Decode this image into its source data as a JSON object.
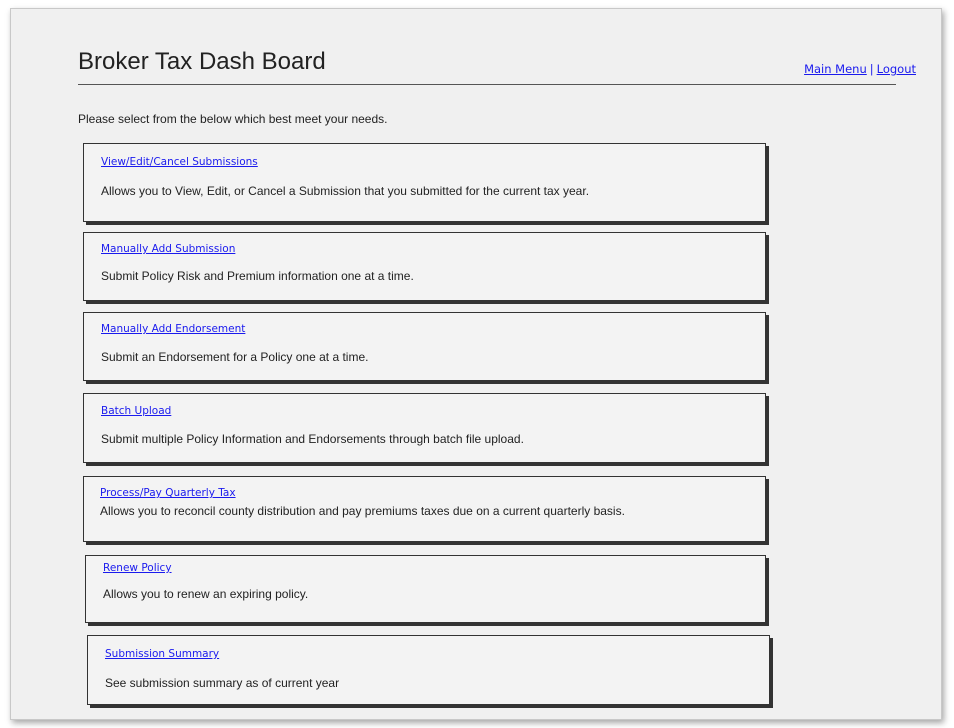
{
  "header": {
    "title": "Broker Tax Dash Board",
    "nav": {
      "main_menu": "Main Menu",
      "separator": "|",
      "logout": "Logout"
    }
  },
  "intro_text": "Please select from the below which best meet your needs.",
  "options": [
    {
      "link": "View/Edit/Cancel Submissions",
      "description": "Allows you to View, Edit, or Cancel a Submission that you submitted for the current tax year."
    },
    {
      "link": "Manually Add Submission",
      "description": "Submit Policy Risk and Premium information one at a time."
    },
    {
      "link": "Manually Add Endorsement",
      "description": "Submit an Endorsement for a Policy one at a time."
    },
    {
      "link": "Batch Upload",
      "description": "Submit multiple Policy Information and Endorsements through batch file upload."
    },
    {
      "link": "Process/Pay Quarterly Tax",
      "description": "Allows you to reconcil county distribution and pay premiums taxes due on a current quarterly basis."
    },
    {
      "link": "Renew Policy",
      "description": "Allows you to renew an expiring policy."
    },
    {
      "link": "Submission Summary",
      "description": "See submission summary as of current year"
    }
  ],
  "colors": {
    "link": "#1a1aee",
    "background": "#f0f0f0",
    "card_border": "#333333"
  }
}
